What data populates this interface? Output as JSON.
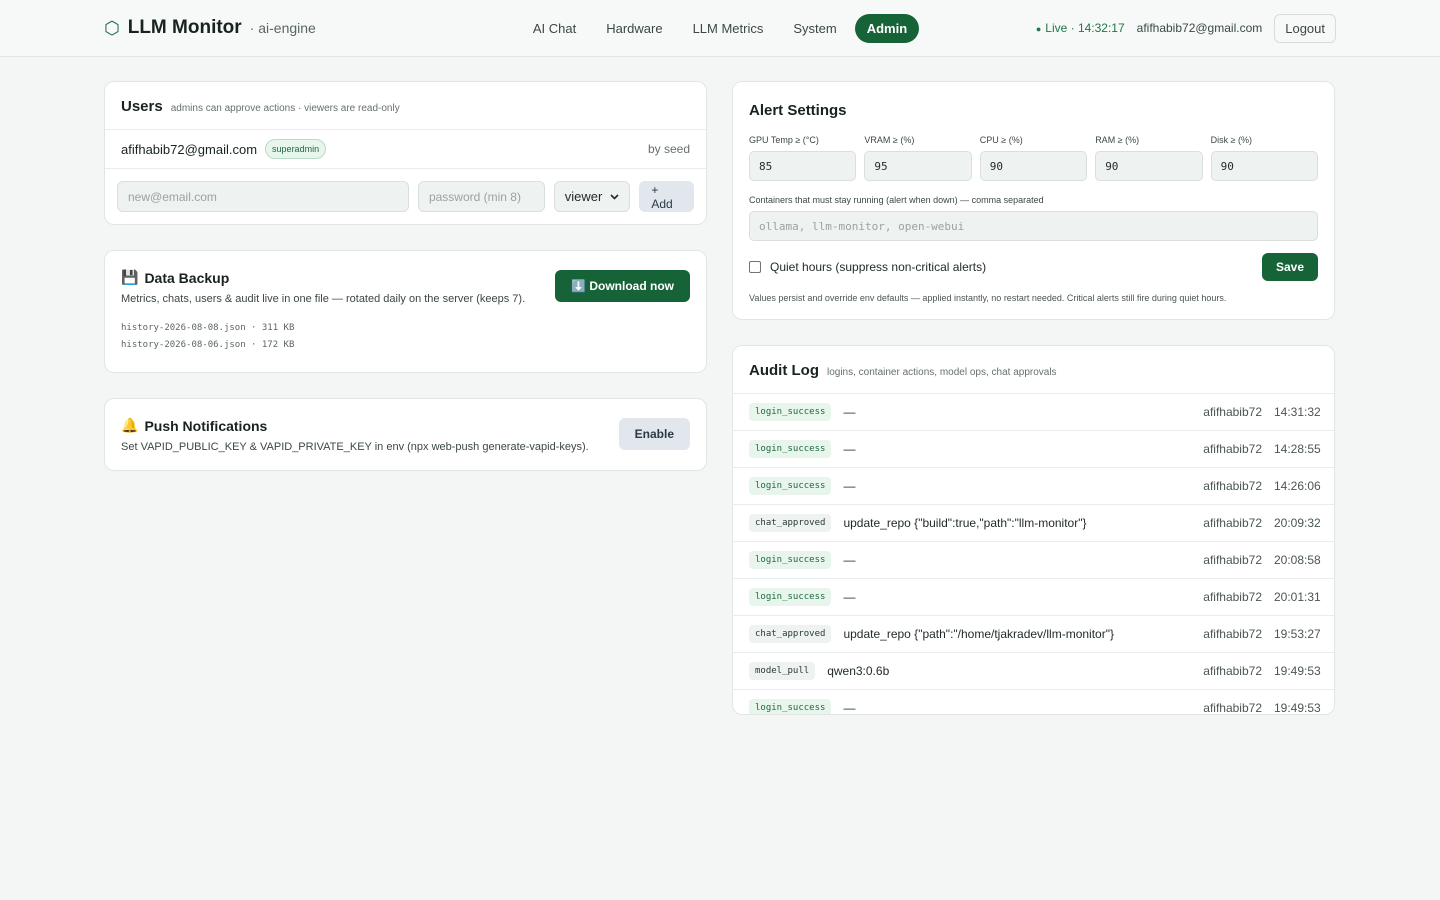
{
  "header": {
    "logo_glyph": "⬡",
    "title": "LLM Monitor",
    "host": "· ai-engine",
    "nav": [
      {
        "label": "AI Chat"
      },
      {
        "label": "Hardware"
      },
      {
        "label": "LLM Metrics"
      },
      {
        "label": "System"
      },
      {
        "label": "Admin"
      }
    ],
    "active_tab": "Admin",
    "live_text": "Live · 14:32:17",
    "user_email": "afifhabib72@gmail.com",
    "logout_label": "Logout"
  },
  "users": {
    "title": "Users",
    "subtitle": "admins can approve actions · viewers are read-only",
    "rows": [
      {
        "email": "afifhabib72@gmail.com",
        "role": "superadmin",
        "origin": "by seed"
      }
    ],
    "new_email_placeholder": "new@email.com",
    "password_placeholder": "password (min 8)",
    "role_select_value": "viewer",
    "add_label": "+ Add"
  },
  "backup": {
    "icon": "💾",
    "title": "Data Backup",
    "description": "Metrics, chats, users & audit live in one file — rotated daily on the server (keeps 7).",
    "download_label": "⬇️ Download now",
    "files": [
      "history-2026-08-08.json · 311 KB",
      "history-2026-08-06.json · 172 KB"
    ]
  },
  "push": {
    "icon": "🔔",
    "title": "Push Notifications",
    "description": "Set VAPID_PUBLIC_KEY & VAPID_PRIVATE_KEY in env (npx web-push generate-vapid-keys).",
    "enable_label": "Enable"
  },
  "alert_settings": {
    "title": "Alert Settings",
    "thresholds": [
      {
        "label": "GPU Temp ≥ (°C)",
        "value": "85"
      },
      {
        "label": "VRAM ≥ (%)",
        "value": "95"
      },
      {
        "label": "CPU ≥ (%)",
        "value": "90"
      },
      {
        "label": "RAM ≥ (%)",
        "value": "90"
      },
      {
        "label": "Disk ≥ (%)",
        "value": "90"
      }
    ],
    "containers_label": "Containers that must stay running (alert when down) — comma separated",
    "containers_placeholder": "ollama, llm-monitor, open-webui",
    "quiet_hours_label": "Quiet hours (suppress non-critical alerts)",
    "quiet_hours_checked": false,
    "save_label": "Save",
    "note": "Values persist and override env defaults — applied instantly, no restart needed. Critical alerts still fire during quiet hours."
  },
  "audit": {
    "title": "Audit Log",
    "subtitle": "logins, container actions, model ops, chat approvals",
    "rows": [
      {
        "action": "login_success",
        "detail": "—",
        "user": "afifhabib72",
        "time": "14:31:32"
      },
      {
        "action": "login_success",
        "detail": "—",
        "user": "afifhabib72",
        "time": "14:28:55"
      },
      {
        "action": "login_success",
        "detail": "—",
        "user": "afifhabib72",
        "time": "14:26:06"
      },
      {
        "action": "chat_approved",
        "detail": "update_repo {\"build\":true,\"path\":\"llm-monitor\"}",
        "user": "afifhabib72",
        "time": "20:09:32"
      },
      {
        "action": "login_success",
        "detail": "—",
        "user": "afifhabib72",
        "time": "20:08:58"
      },
      {
        "action": "login_success",
        "detail": "—",
        "user": "afifhabib72",
        "time": "20:01:31"
      },
      {
        "action": "chat_approved",
        "detail": "update_repo {\"path\":\"/home/tjakradev/llm-monitor\"}",
        "user": "afifhabib72",
        "time": "19:53:27"
      },
      {
        "action": "model_pull",
        "detail": "qwen3:0.6b",
        "user": "afifhabib72",
        "time": "19:49:53"
      },
      {
        "action": "login_success",
        "detail": "—",
        "user": "afifhabib72",
        "time": "19:49:53"
      }
    ]
  },
  "colors": {
    "accent": "#176338",
    "live": "#1c7a45",
    "badge_green_bg": "#e8f5ec"
  }
}
